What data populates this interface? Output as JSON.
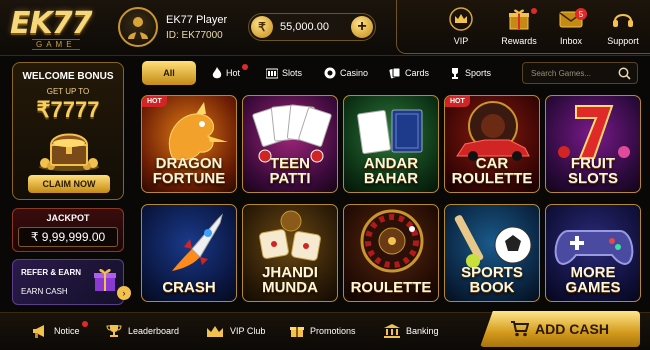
{
  "brand": {
    "logo": "EK77",
    "logo_sub": "GAME"
  },
  "player": {
    "name": "EK77 Player",
    "id": "ID: EK77000",
    "balance": "55,000.00",
    "currency_icon": "₹"
  },
  "quick": [
    {
      "label": "VIP",
      "icon": "crown-icon"
    },
    {
      "label": "Rewards",
      "icon": "gift-icon"
    },
    {
      "label": "Inbox",
      "icon": "mail-icon",
      "badge": "5"
    },
    {
      "label": "Support",
      "icon": "headset-icon"
    }
  ],
  "welcome": {
    "title": "WELCOME BONUS",
    "subtitle": "GET UP TO",
    "amount": "₹7777",
    "claim": "CLAIM NOW"
  },
  "jackpot": {
    "title": "JACKPOT",
    "amount": "₹ 9,99,999.00"
  },
  "refer": {
    "title": "REFER & EARN",
    "subtitle": "EARN CASH"
  },
  "filters": {
    "all": "All",
    "hot": "Hot",
    "slots": "Slots",
    "casino": "Casino",
    "cards": "Cards",
    "sports": "Sports",
    "selected": "All"
  },
  "search": {
    "placeholder": "Search Games..."
  },
  "hot_badge": "HOT",
  "games": [
    {
      "line1": "DRAGON",
      "line2": "FORTUNE",
      "hot": true
    },
    {
      "line1": "TEEN",
      "line2": "PATTI",
      "hot": false
    },
    {
      "line1": "ANDAR",
      "line2": "BAHAR",
      "hot": false
    },
    {
      "line1": "CAR",
      "line2": "ROULETTE",
      "hot": true
    },
    {
      "line1": "FRUIT",
      "line2": "SLOTS",
      "hot": false
    },
    {
      "line1": "CRASH",
      "line2": "",
      "hot": false
    },
    {
      "line1": "JHANDI",
      "line2": "MUNDA",
      "hot": false
    },
    {
      "line1": "ROULETTE",
      "line2": "",
      "hot": false
    },
    {
      "line1": "SPORTS",
      "line2": "BOOK",
      "hot": false
    },
    {
      "line1": "MORE",
      "line2": "GAMES",
      "hot": false
    }
  ],
  "bottom": {
    "notice": "Notice",
    "leaderboard": "Leaderboard",
    "vip_club": "VIP Club",
    "promotions": "Promotions",
    "banking": "Banking",
    "add_cash": "ADD CASH"
  },
  "colors": {
    "gold": "#f2c14e",
    "dark": "#0a0806",
    "hot_red": "#d12424"
  }
}
